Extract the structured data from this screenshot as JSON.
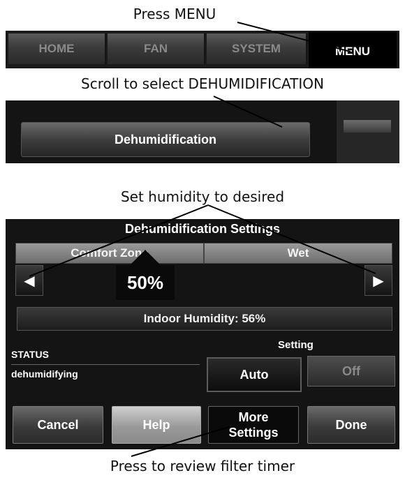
{
  "captions": {
    "step1": "Press MENU",
    "step2": "Scroll to select DEHUMIDIFICATION",
    "step3": "Set humidity to desired",
    "step4": "Press to review filter timer"
  },
  "menu_bar": {
    "tabs": [
      {
        "label": "HOME"
      },
      {
        "label": "FAN"
      },
      {
        "label": "SYSTEM"
      },
      {
        "label": "MENU"
      }
    ]
  },
  "menu_list": {
    "item_label": "Dehumidification"
  },
  "settings": {
    "title": "Dehumidification Settings",
    "zone_left": "Comfort Zone",
    "zone_right": "Wet",
    "value": "50%",
    "indoor_humidity": "Indoor Humidity: 56%",
    "status_label": "STATUS",
    "status_value": "dehumidifying",
    "setting_label": "Setting",
    "auto_label": "Auto",
    "off_label": "Off",
    "left_arrow": "◀",
    "right_arrow": "▶"
  },
  "buttons": {
    "cancel": "Cancel",
    "help": "Help",
    "more_line1": "More",
    "more_line2": "Settings",
    "done": "Done"
  },
  "colors": {
    "panel_bg": "#141414",
    "active_tab": "#000000",
    "highlight": "#ffffff"
  }
}
